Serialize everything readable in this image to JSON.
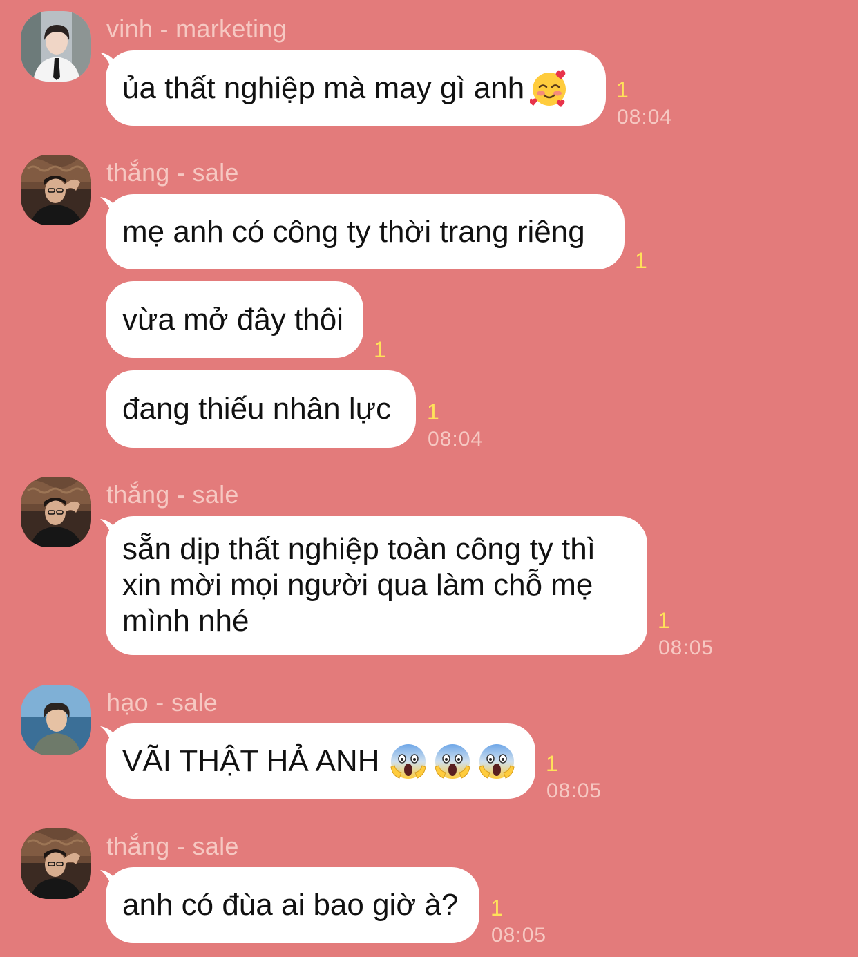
{
  "messages": [
    {
      "sender": "vinh - marketing",
      "avatar": "avatar-man-suit-tie",
      "bubbles": [
        {
          "text": "ủa thất nghiệp mà may gì anh",
          "emojis": [
            "smiling-face-with-hearts"
          ],
          "count": "1",
          "time": "08:04"
        }
      ]
    },
    {
      "sender": "thắng - sale",
      "avatar": "avatar-man-hand-on-head",
      "bubbles": [
        {
          "text": "mẹ anh có công ty thời trang riêng",
          "count": "1"
        },
        {
          "text": "vừa mở đây thôi",
          "count": "1"
        },
        {
          "text": "đang thiếu nhân lực",
          "count": "1",
          "time": "08:04"
        }
      ]
    },
    {
      "sender": "thắng - sale",
      "avatar": "avatar-man-hand-on-head",
      "bubbles": [
        {
          "text": "sẵn dịp thất nghiệp toàn công ty thì xin mời mọi người qua làm chỗ mẹ mình nhé",
          "count": "1",
          "time": "08:05"
        }
      ]
    },
    {
      "sender": "hạo - sale",
      "avatar": "avatar-man-sea-background",
      "bubbles": [
        {
          "text": "VÃI THẬT HẢ ANH",
          "emojis": [
            "screaming-face",
            "screaming-face",
            "screaming-face"
          ],
          "count": "1",
          "time": "08:05"
        }
      ]
    },
    {
      "sender": "thắng - sale",
      "avatar": "avatar-man-hand-on-head",
      "bubbles": [
        {
          "text": "anh có đùa ai bao giờ à?",
          "count": "1",
          "time": "08:05"
        }
      ]
    }
  ],
  "colors": {
    "background": "#e37b7b",
    "bubble": "#ffffff",
    "sender_text": "#f6c8c2",
    "unread_count": "#ffe25a",
    "timestamp": "#f6c8c2"
  }
}
